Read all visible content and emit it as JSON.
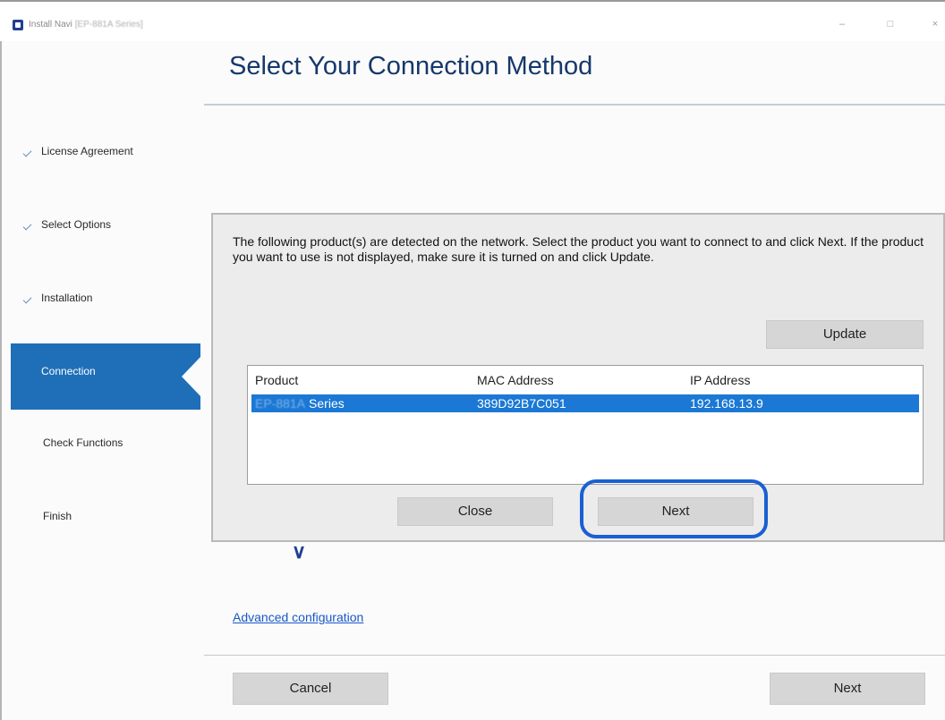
{
  "window": {
    "title_prefix": "Install Navi",
    "title_model": "[EP-881A Series]",
    "minimize_glyph": "–",
    "maximize_glyph": "□",
    "close_glyph": "×"
  },
  "header": {
    "title": "Select Your Connection Method"
  },
  "sidebar": {
    "steps": [
      {
        "label": "License Agreement",
        "state": "done"
      },
      {
        "label": "Select Options",
        "state": "done"
      },
      {
        "label": "Installation",
        "state": "done"
      },
      {
        "label": "Connection",
        "state": "current"
      },
      {
        "label": "Check Functions",
        "state": "pending"
      },
      {
        "label": "Finish",
        "state": "pending"
      }
    ]
  },
  "dialog": {
    "message": "The following product(s) are detected on the network. Select the product you want to connect to and click Next. If the product you want to use is not displayed, make sure it is turned on and click Update.",
    "update_label": "Update",
    "columns": {
      "product": "Product",
      "mac": "MAC Address",
      "ip": "IP Address"
    },
    "rows": [
      {
        "model": "EP-881A",
        "series": "Series",
        "mac": "389D92B7C051",
        "ip": "192.168.13.9",
        "selected": true
      }
    ],
    "close_label": "Close",
    "next_label": "Next"
  },
  "advanced_link": "Advanced configuration",
  "footer": {
    "cancel_label": "Cancel",
    "next_label": "Next"
  },
  "colors": {
    "accent": "#1e6fb8",
    "selection": "#1b78d4",
    "title": "#16386b",
    "highlight_ring": "#1a5fd3",
    "link": "#1a56c9"
  }
}
